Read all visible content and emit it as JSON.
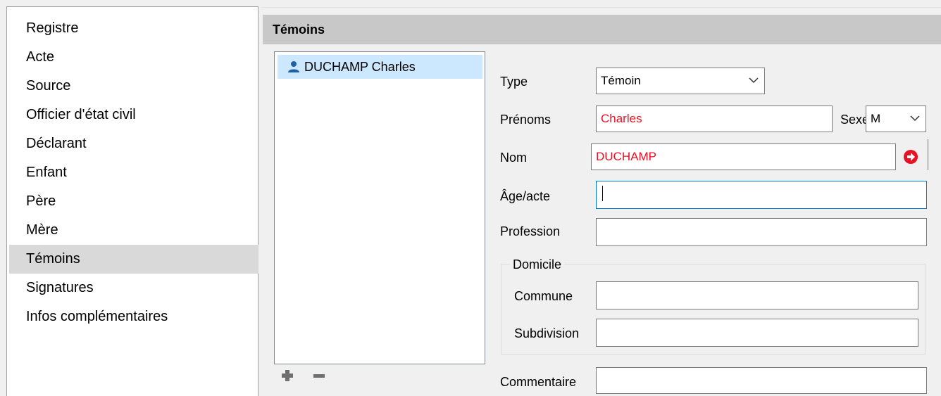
{
  "nav": {
    "items": [
      {
        "label": "Registre"
      },
      {
        "label": "Acte"
      },
      {
        "label": "Source"
      },
      {
        "label": "Officier d'état civil"
      },
      {
        "label": "Déclarant"
      },
      {
        "label": "Enfant"
      },
      {
        "label": "Père"
      },
      {
        "label": "Mère"
      },
      {
        "label": "Témoins"
      },
      {
        "label": "Signatures"
      },
      {
        "label": "Infos complémentaires"
      }
    ],
    "selected": "Témoins"
  },
  "panel": {
    "title": "Témoins",
    "witnesses": [
      {
        "name": "DUCHAMP Charles",
        "icon": "person-icon"
      }
    ],
    "toolbar": {
      "add_icon": "plus-icon",
      "remove_icon": "minus-icon"
    }
  },
  "form": {
    "type_label": "Type",
    "type_value": "Témoin",
    "prenoms_label": "Prénoms",
    "prenoms_value": "Charles",
    "sexe_label": "Sexe",
    "sexe_value": "M",
    "nom_label": "Nom",
    "nom_value": "DUCHAMP",
    "nom_button_icon": "arrow-right-icon",
    "age_label": "Âge/acte",
    "age_value": "",
    "profession_label": "Profession",
    "profession_value": "",
    "domicile_label": "Domicile",
    "commune_label": "Commune",
    "commune_value": "",
    "subdivision_label": "Subdivision",
    "subdivision_value": "",
    "commentaire_label": "Commentaire",
    "commentaire_value": ""
  },
  "colors": {
    "highlight_text": "#e81123",
    "selected_list": "#cce8ff",
    "header_bg": "#c8c8c8",
    "accent": "#0078d7"
  }
}
